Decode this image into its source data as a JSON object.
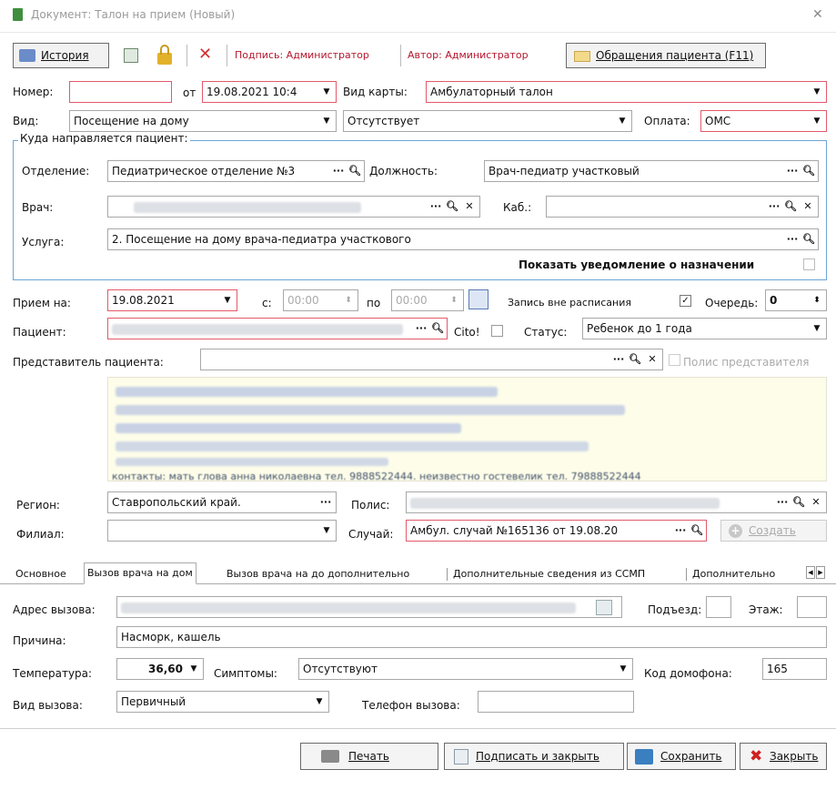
{
  "window": {
    "title": "Документ: Талон на прием (Новый)",
    "close": "✕"
  },
  "toolbar": {
    "history": "История",
    "signature": "Подпись: Администратор",
    "author": "Автор: Администратор",
    "patient_visits": "Обращения пациента (F11)"
  },
  "header": {
    "number_label": "Номер:",
    "number_value": "",
    "from_label": "от",
    "date_value": "19.08.2021 10:4",
    "card_type_label": "Вид карты:",
    "card_type_value": "Амбулаторный талон",
    "kind_label": "Вид:",
    "kind_value": "Посещение на дому",
    "kind2_value": "Отсутствует",
    "payment_label": "Оплата:",
    "payment_value": "ОМС"
  },
  "referral": {
    "group_title": "Куда направляется пациент:",
    "department_label": "Отделение:",
    "department_value": "Педиатрическое отделение №3",
    "position_label": "Должность:",
    "position_value": "Врач-педиатр участковый",
    "doctor_label": "Врач:",
    "cabinet_label": "Каб.:",
    "service_label": "Услуга:",
    "service_value": "2. Посещение на дому врача-педиатра участкового",
    "show_notice": "Показать уведомление о назначении"
  },
  "appointment": {
    "label": "Прием на:",
    "date": "19.08.2021",
    "from_label": "с:",
    "from_time": "00:00",
    "to_label": "по",
    "to_time": "00:00",
    "off_schedule": "Запись вне расписания",
    "queue_label": "Очередь:",
    "queue_value": "0"
  },
  "patient": {
    "label": "Пациент:",
    "cito_label": "Cito!",
    "status_label": "Статус:",
    "status_value": "Ребенок до 1 года",
    "rep_label": "Представитель пациента:",
    "rep_policy": "Полис представителя",
    "info_partial": "контакты: мать глова анна николаевна тел. 9888522444. неизвестно гостевелик тел. 79888522444"
  },
  "insurance": {
    "region_label": "Регион:",
    "region_value": "Ставропольский край.",
    "policy_label": "Полис:",
    "branch_label": "Филиал:",
    "case_label": "Случай:",
    "case_value": "Амбул. случай №165136 от 19.08.20",
    "create": "Создать"
  },
  "tabs": [
    "Основное",
    "Вызов врача на дом",
    "Вызов врача на до дополнительно",
    "Дополнительные сведения из ССМП",
    "Дополнительно"
  ],
  "call": {
    "address_label": "Адрес вызова:",
    "entrance_label": "Подъезд:",
    "floor_label": "Этаж:",
    "reason_label": "Причина:",
    "reason_value": "Насморк, кашель",
    "temp_label": "Температура:",
    "temp_value": "36,60",
    "symptoms_label": "Симптомы:",
    "symptoms_value": "Отсутствуют",
    "intercom_label": "Код домофона:",
    "intercom_value": "165",
    "calltype_label": "Вид вызова:",
    "calltype_value": "Первичный",
    "phone_label": "Телефон вызова:"
  },
  "footer": {
    "print": "Печать",
    "sign_close": "Подписать и закрыть",
    "save": "Сохранить",
    "close": "Закрыть"
  },
  "colors": {
    "required_border": "#e35a6a",
    "group_border": "#6aa6d8",
    "info_bg": "#fdfde9"
  }
}
